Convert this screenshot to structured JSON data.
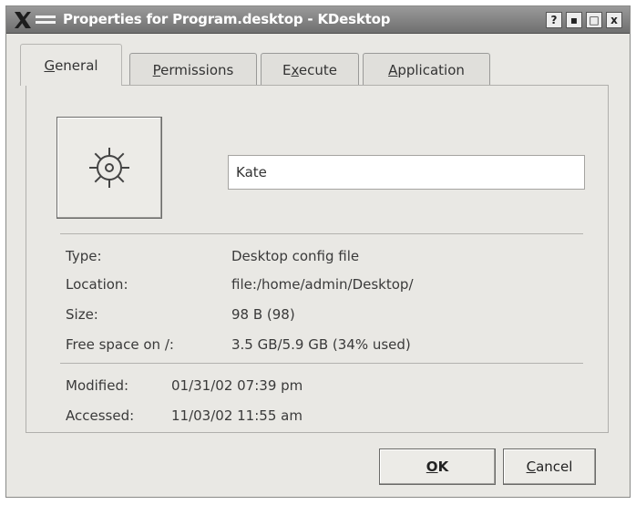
{
  "window": {
    "title": "Properties for Program.desktop - KDesktop",
    "controls": {
      "help": "?",
      "minimize": "▪",
      "maximize": "□",
      "close": "x"
    }
  },
  "tabs": [
    {
      "label_pre": "",
      "label_key": "G",
      "label_post": "eneral",
      "active": true
    },
    {
      "label_pre": "",
      "label_key": "P",
      "label_post": "ermissions",
      "active": false
    },
    {
      "label_pre": "E",
      "label_key": "x",
      "label_post": "ecute",
      "active": false
    },
    {
      "label_pre": "",
      "label_key": "A",
      "label_post": "pplication",
      "active": false
    }
  ],
  "general": {
    "icon": "gear-icon",
    "name_value": "Kate",
    "type_label": "Type:",
    "type_value": "Desktop config file",
    "location_label": "Location:",
    "location_value": "file:/home/admin/Desktop/",
    "size_label": "Size:",
    "size_value": "98 B (98)",
    "free_label": "Free space on /:",
    "free_value": "3.5 GB/5.9 GB (34% used)",
    "modified_label": "Modified:",
    "modified_value": "01/31/02 07:39 pm",
    "accessed_label": "Accessed:",
    "accessed_value": "11/03/02 11:55 am"
  },
  "buttons": {
    "ok_key": "O",
    "ok_rest": "K",
    "cancel_key": "C",
    "cancel_rest": "ancel"
  }
}
